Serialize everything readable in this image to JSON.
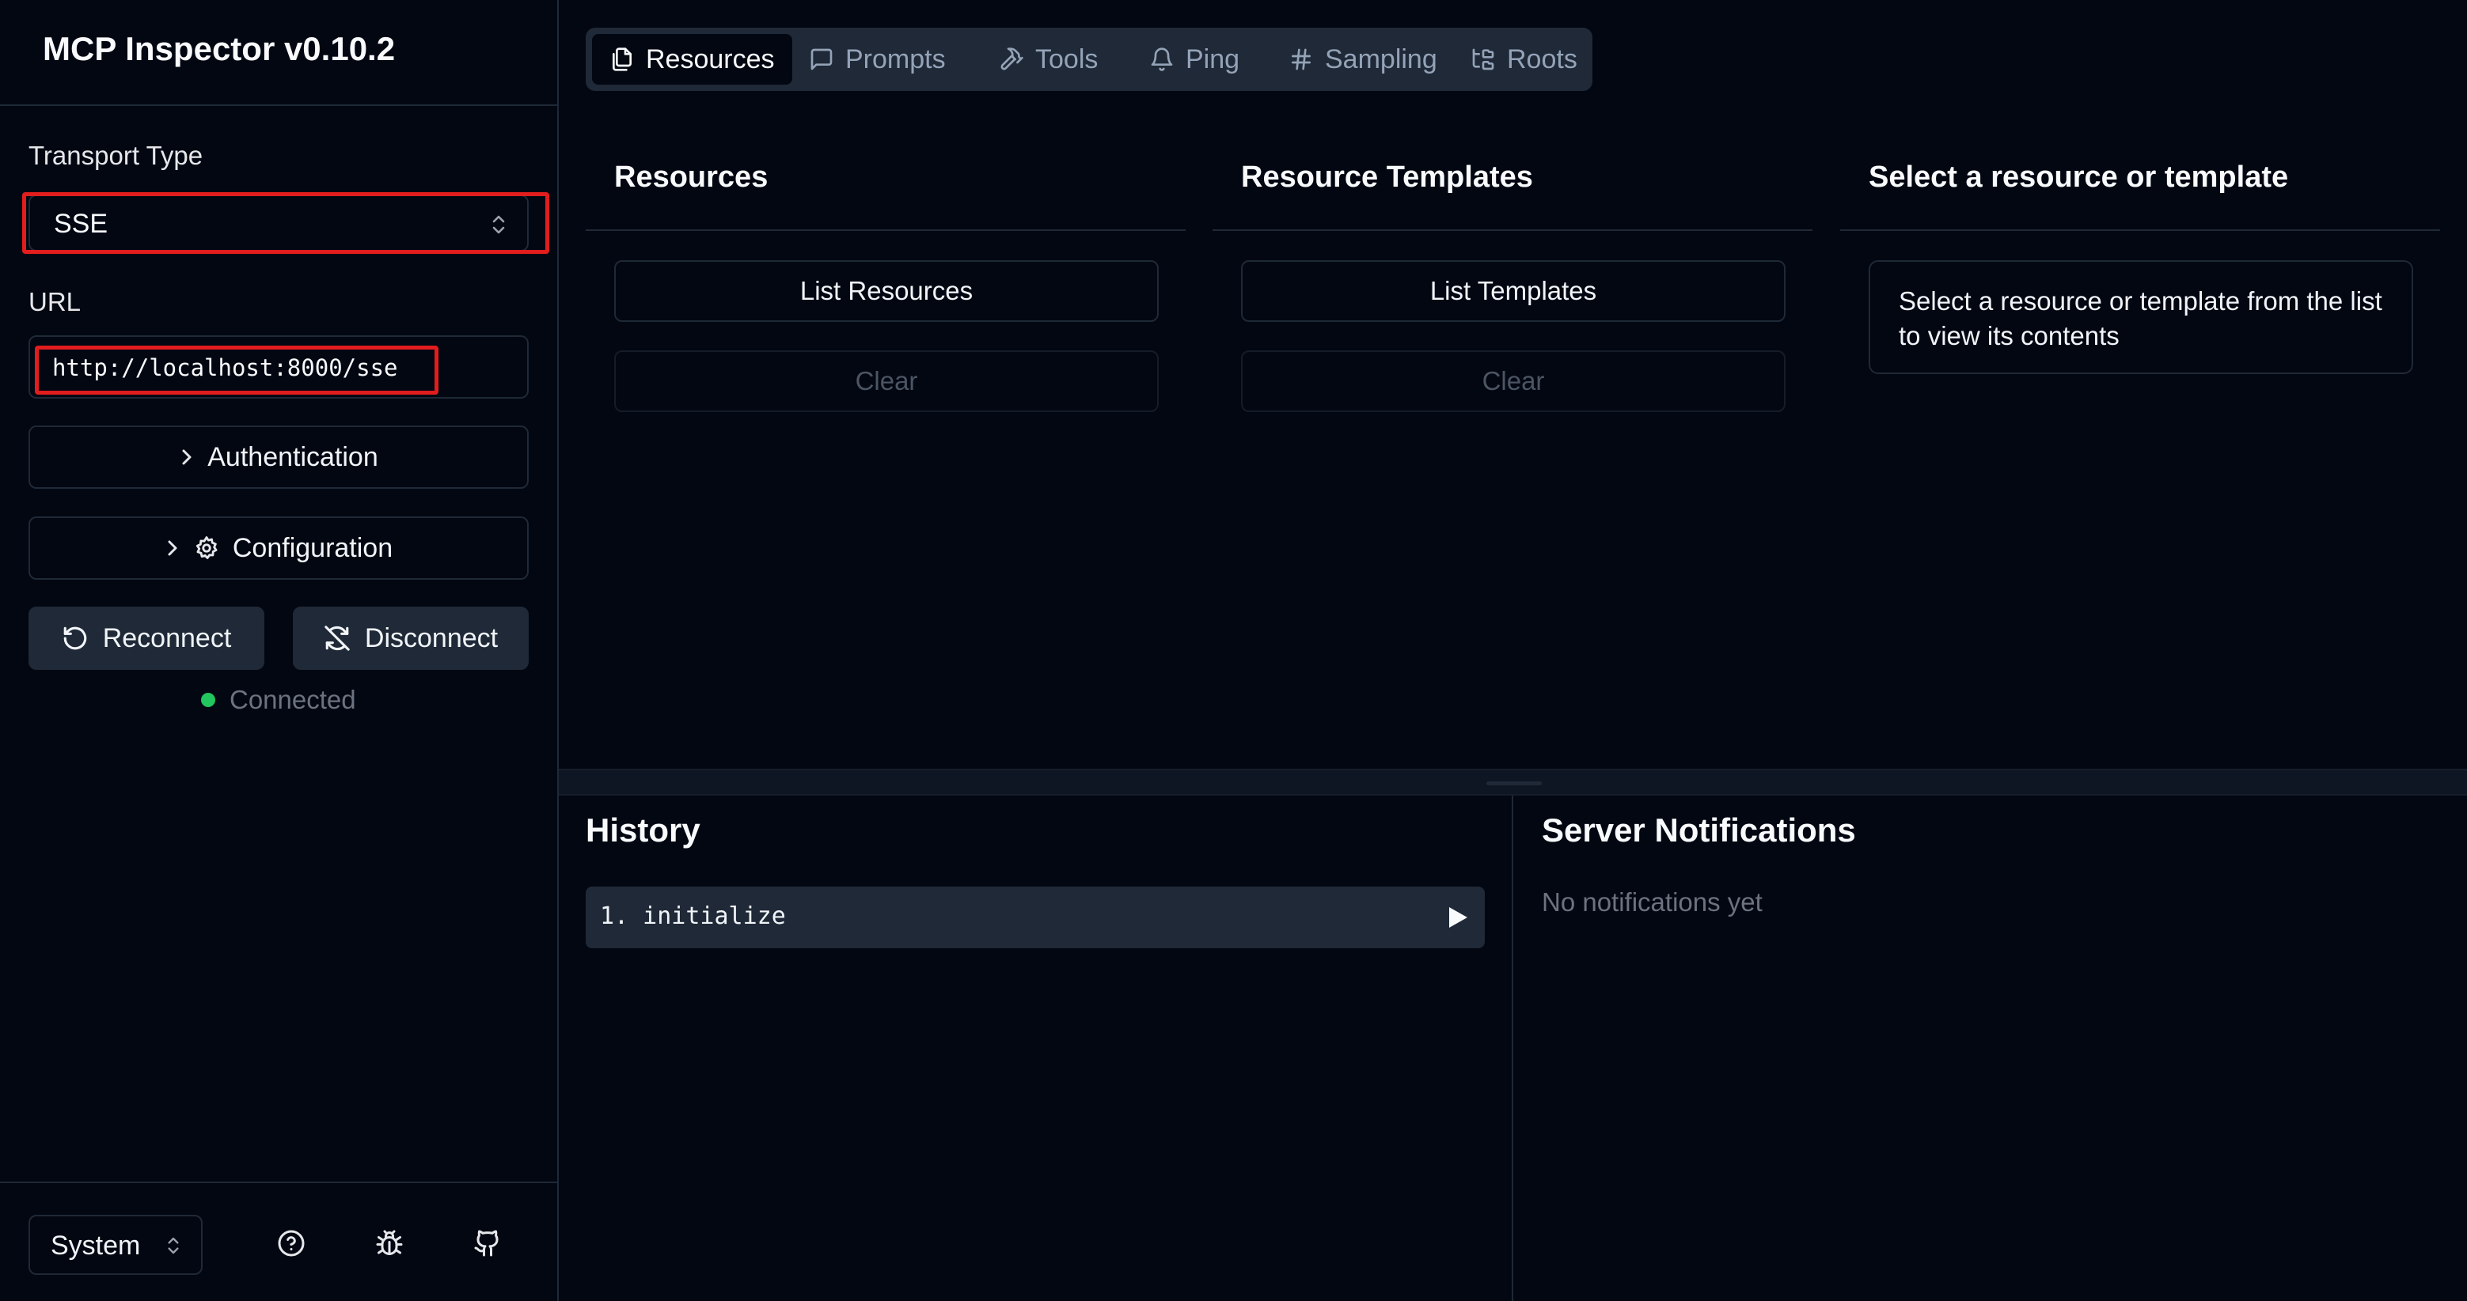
{
  "app": {
    "title": "MCP Inspector v0.10.2"
  },
  "sidebar": {
    "transport_label": "Transport Type",
    "transport_value": "SSE",
    "url_label": "URL",
    "url_value": "http://localhost:8000/sse",
    "authentication_label": "Authentication",
    "configuration_label": "Configuration",
    "reconnect_label": "Reconnect",
    "disconnect_label": "Disconnect",
    "status_text": "Connected",
    "status_color": "#22c55e",
    "theme_value": "System",
    "footer_icons": [
      "help-circle-icon",
      "bug-icon",
      "github-icon"
    ]
  },
  "tabs": [
    {
      "label": "Resources",
      "icon": "files-icon",
      "active": true
    },
    {
      "label": "Prompts",
      "icon": "message-square-icon",
      "active": false
    },
    {
      "label": "Tools",
      "icon": "hammer-icon",
      "active": false
    },
    {
      "label": "Ping",
      "icon": "bell-icon",
      "active": false
    },
    {
      "label": "Sampling",
      "icon": "hash-icon",
      "active": false
    },
    {
      "label": "Roots",
      "icon": "folder-tree-icon",
      "active": false
    }
  ],
  "resources": {
    "title": "Resources",
    "list_button": "List Resources",
    "clear_button": "Clear"
  },
  "templates": {
    "title": "Resource Templates",
    "list_button": "List Templates",
    "clear_button": "Clear"
  },
  "detail": {
    "title": "Select a resource or template",
    "message": "Select a resource or template from the list to view its contents"
  },
  "history": {
    "title": "History",
    "items": [
      "1. initialize"
    ]
  },
  "notifications": {
    "title": "Server Notifications",
    "empty_text": "No notifications yet"
  },
  "colors": {
    "background": "#030712",
    "border": "#1f2937",
    "highlight": "#e11d1d"
  }
}
